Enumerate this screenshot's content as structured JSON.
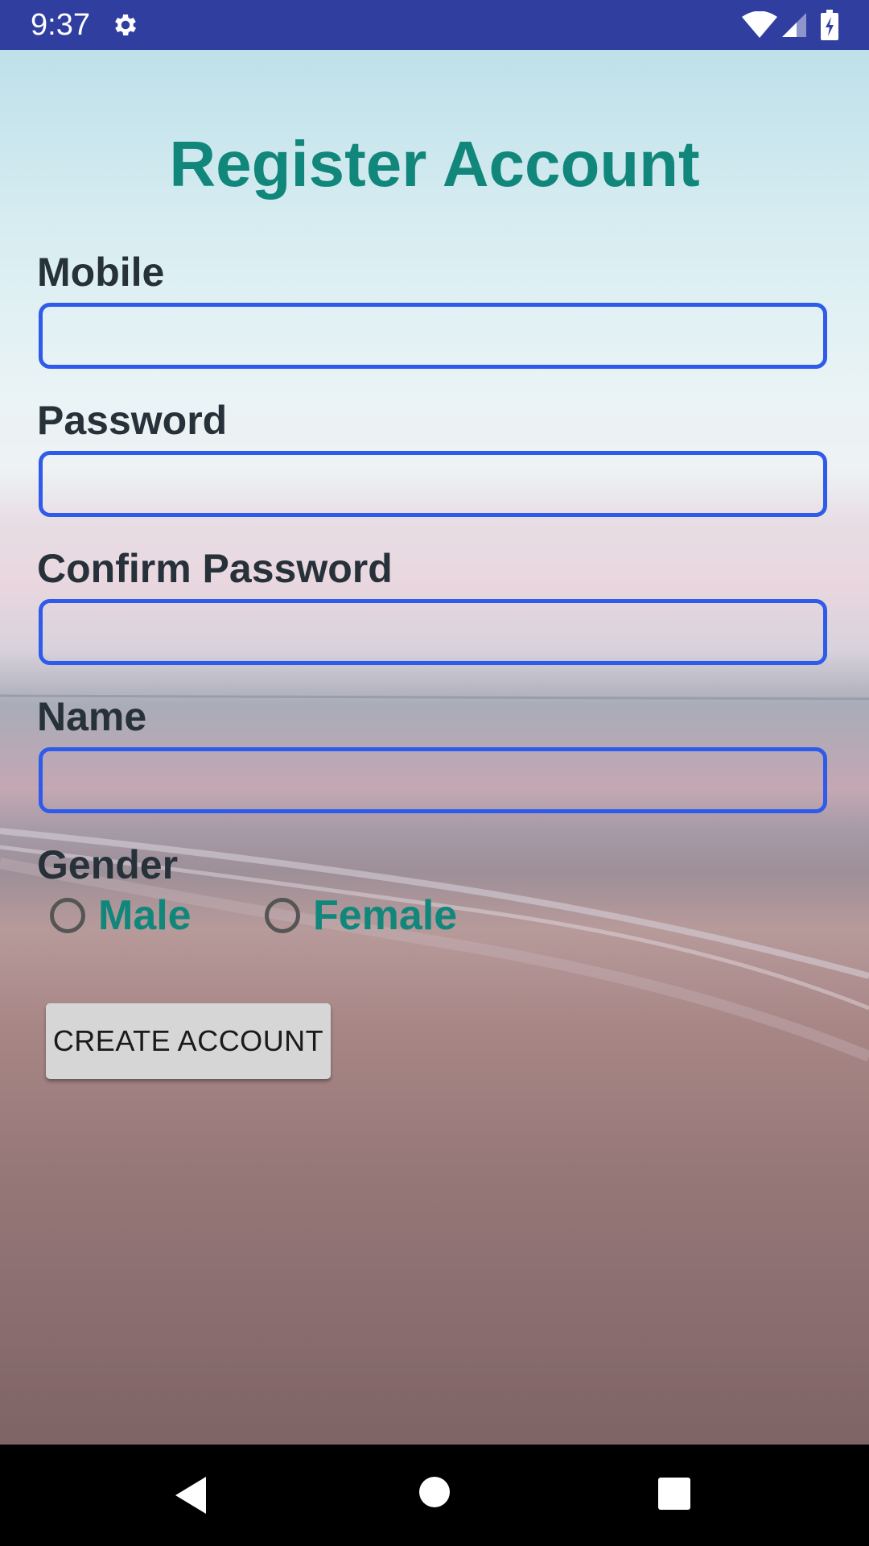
{
  "status_bar": {
    "time": "9:37",
    "icons": [
      "gear-icon",
      "wifi-icon",
      "signal-icon",
      "battery-charging-icon"
    ],
    "background_color": "#303F9F"
  },
  "form": {
    "title": "Register Account",
    "title_color": "#11877B",
    "fields": [
      {
        "label": "Mobile",
        "value": "",
        "placeholder": ""
      },
      {
        "label": "Password",
        "value": "",
        "placeholder": ""
      },
      {
        "label": "Confirm Password",
        "value": "",
        "placeholder": ""
      },
      {
        "label": "Name",
        "value": "",
        "placeholder": ""
      }
    ],
    "input_border_color": "#2F5BEA",
    "gender": {
      "label": "Gender",
      "options": [
        {
          "label": "Male",
          "selected": false
        },
        {
          "label": "Female",
          "selected": false
        }
      ]
    },
    "submit_label": "CREATE ACCOUNT"
  },
  "nav_bar": {
    "icons": [
      "back-icon",
      "home-icon",
      "recents-icon"
    ]
  }
}
